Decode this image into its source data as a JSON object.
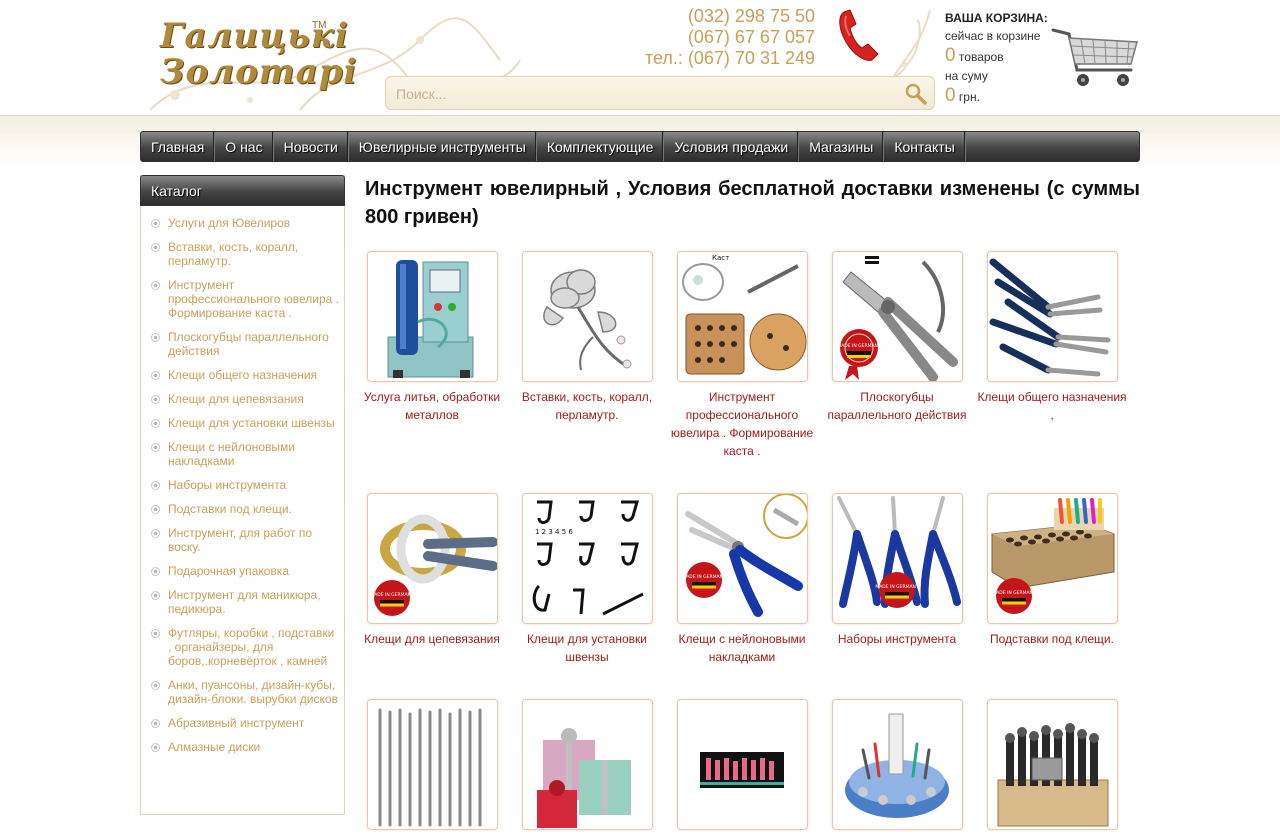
{
  "header": {
    "logo": {
      "line1": "Галицькі",
      "line2": "Золотарі",
      "tm": "TM"
    },
    "phones": [
      "(032) 298 75 50",
      "(067) 67 67 057",
      "тел.: (067) 70 31 249"
    ],
    "search_placeholder": "Поиск..."
  },
  "cart": {
    "title": "ВАША КОРЗИНА:",
    "in_cart_text": "сейчас в корзине",
    "items_count": "0",
    "items_label": "товаров",
    "sum_text": "на суму",
    "sum_value": "0",
    "currency": "грн."
  },
  "nav": {
    "items": [
      "Главная",
      "О нас",
      "Новости",
      "Ювелирные инструменты",
      "Комплектующие",
      "Условия продажи",
      "Магазины",
      "Контакты"
    ]
  },
  "sidebar": {
    "title": "Каталог",
    "items": [
      "Услуги для Ювелиров",
      "Вставки, кость, коралл, перламутр.",
      "Инструмент профессионального ювелира . Формирование каста .",
      "Плоскогубцы параллельного действия",
      "Клещи общего назначения",
      "Клещи для цепевязания",
      "Клещи для установки швензы",
      "Клещи с нейлоновыми накладками",
      "Наборы инструмента",
      "Подставки под клещи.",
      "Инструмент, для работ по воску.",
      "Подарочная упаковка",
      "Инструмент для маникюра, педикюра.",
      "Футляры, коробки , подставки , органайзеры, для боров,.корневёрток , камней",
      "Анки, пуансоны, дизайн-кубы, дизайн-блоки. вырубки дисков",
      "Абразивный инструмент",
      "Алмазные диски"
    ]
  },
  "content": {
    "title": "Инструмент ювелирный , Условия бесплатной доставки изменены (с суммы 800 гривен)"
  },
  "products": [
    {
      "label": "Услуга литья, обработки металлов",
      "icon": "casting-machine-image"
    },
    {
      "label": "Вставки, кость, коралл, перламутр.",
      "icon": "silver-rose-image"
    },
    {
      "label": "Инструмент профессионального ювелира . Формирование каста .",
      "icon": "setting-tools-image",
      "badge_text": "Каст"
    },
    {
      "label": "Плоскогубцы параллельного действия",
      "icon": "parallel-pliers-image",
      "badge_text": "MADE IN GERMANY"
    },
    {
      "label": "Клещи общего назначения ,",
      "icon": "general-pliers-image"
    },
    {
      "label": "Клещи для цепевязания",
      "icon": "chain-pliers-image",
      "badge_text": "MADE IN GERMANY"
    },
    {
      "label": "Клещи для установки швензы",
      "icon": "hook-diagram-image",
      "badge_text": "1 2 3 4 5 6"
    },
    {
      "label": "Клещи с нейлоновыми накладками",
      "icon": "nylon-pliers-image",
      "badge_text": "MADE IN GERMANY"
    },
    {
      "label": "Наборы инструмента",
      "icon": "plier-set-image",
      "badge_text": "MADE IN GERMANY"
    },
    {
      "label": "Подставки под клещи.",
      "icon": "plier-stand-image",
      "badge_text": "MADE IN GERMANY"
    },
    {
      "label": "",
      "icon": "wax-tools-image"
    },
    {
      "label": "",
      "icon": "gift-boxes-image"
    },
    {
      "label": "",
      "icon": "manicure-bits-image"
    },
    {
      "label": "",
      "icon": "organizer-image"
    },
    {
      "label": "",
      "icon": "punch-set-image"
    }
  ],
  "colors": {
    "accent_gold": "#c8a05a",
    "link_red": "#a31b1b",
    "nav_dark": "#3a3a3a"
  }
}
